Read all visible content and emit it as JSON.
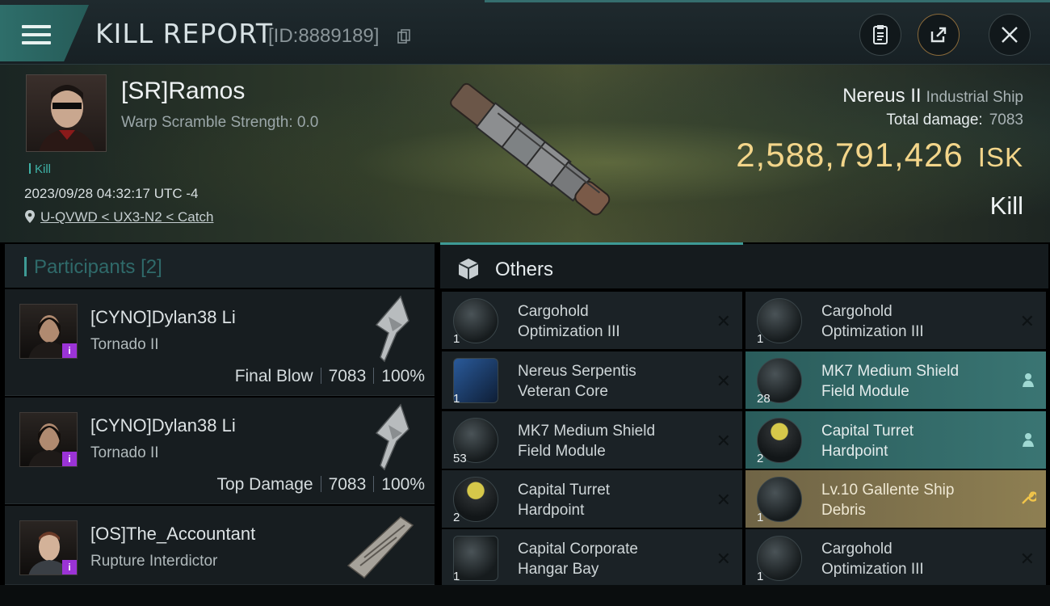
{
  "header": {
    "title": "KILL REPORT",
    "report_id": "[ID:8889189]"
  },
  "victim": {
    "name": "[SR]Ramos",
    "warp_scramble": "Warp Scramble Strength: 0.0",
    "tag": "Kill",
    "timestamp": "2023/09/28 04:32:17 UTC -4",
    "location": "U-QVWD < UX3-N2 < Catch",
    "ship_name": "Nereus II",
    "ship_class": "Industrial Ship",
    "total_damage_label": "Total damage:",
    "total_damage_value": "7083",
    "isk_value": "2,588,791,426",
    "isk_unit": "ISK",
    "result": "Kill"
  },
  "participants": {
    "title": "Participants",
    "count": "[2]",
    "rows": [
      {
        "name": "[CYNO]Dylan38 Li",
        "ship": "Tornado II",
        "label": "Final Blow",
        "damage": "7083",
        "percent": "100%"
      },
      {
        "name": "[CYNO]Dylan38 Li",
        "ship": "Tornado II",
        "label": "Top Damage",
        "damage": "7083",
        "percent": "100%"
      },
      {
        "name": "[OS]The_Accountant",
        "ship": "Rupture Interdictor"
      }
    ]
  },
  "others": {
    "title": "Others",
    "items": [
      {
        "line1": "Cargohold",
        "line2": "Optimization III",
        "qty": "1",
        "icon": "cargohold-module-icon",
        "state": "destroyed"
      },
      {
        "line1": "Cargohold",
        "line2": "Optimization III",
        "qty": "1",
        "icon": "cargohold-module-icon",
        "state": "destroyed"
      },
      {
        "line1": "Nereus Serpentis",
        "line2": "Veteran Core",
        "qty": "1",
        "icon": "core-icon",
        "state": "destroyed"
      },
      {
        "line1": "MK7 Medium Shield",
        "line2": "Field Module",
        "qty": "28",
        "icon": "shield-module-icon",
        "state": "dropped"
      },
      {
        "line1": "MK7 Medium Shield",
        "line2": "Field Module",
        "qty": "53",
        "icon": "shield-module-icon",
        "state": "destroyed"
      },
      {
        "line1": "Capital Turret",
        "line2": "Hardpoint",
        "qty": "2",
        "icon": "turret-hardpoint-icon",
        "state": "dropped"
      },
      {
        "line1": "Capital Turret",
        "line2": "Hardpoint",
        "qty": "2",
        "icon": "turret-hardpoint-icon",
        "state": "destroyed"
      },
      {
        "line1": "Lv.10 Gallente Ship",
        "line2": "Debris",
        "qty": "1",
        "icon": "debris-icon",
        "state": "salvage"
      },
      {
        "line1": "Capital Corporate",
        "line2": "Hangar Bay",
        "qty": "1",
        "icon": "hangar-bay-icon",
        "state": "destroyed"
      },
      {
        "line1": "Cargohold",
        "line2": "Optimization III",
        "qty": "1",
        "icon": "cargohold-module-icon",
        "state": "destroyed"
      }
    ]
  },
  "colors": {
    "accent_teal": "#3e9a95",
    "isk_gold": "#f3d58a",
    "dropped_row": "#3a7573",
    "salvage_row": "#8e7f52",
    "badge_purple": "#9b33d6"
  }
}
